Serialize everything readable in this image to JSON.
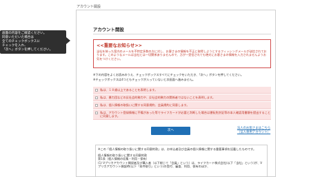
{
  "window": {
    "title": "アカウント開設"
  },
  "tooltip": {
    "lines": [
      "画面の内容をご確認ください。",
      "同意いただいた場合は",
      "全てのチェックボックスに",
      "チェックを入れ、",
      "「次へ」ボタンを押してください。"
    ]
  },
  "page": {
    "title": "アカウント開設"
  },
  "notice": {
    "heading": "<<重要なお知らせ>>",
    "text": "当社を装った案内のメールを不特定多数の方に対し、お客さまの情報を不正に取得しようとするフィッシングメールが送信されております。このようなメールは当社とは一切関係ありませんので、万が一受信されても絶対にお客さまの情報を入力されませんようお気をつけください。"
  },
  "instructions": {
    "line1": "※下の内容をよくお読みのうえ、チェックボックスすべてにチェックをいただき、「次へ」ボタンを押してください。",
    "line2": "※チェックボックスは4つともチェックが入っていないと次画面へ進みません。"
  },
  "agreements": [
    "私は、１８歳以上であることを表明します。",
    "私は、暴力団などの反社会的勢力や、反社会的勢力の関係者ではないことを表明します。",
    "私は、個人情報の取扱いに関する同意規約、会員規約に同意します。",
    "私は、アカウント登録情報に不備があった等でライフカードが必要と判断した場合は運転免許証等の本人確認用書類を提出することに同意します。"
  ],
  "buttons": {
    "next": "次へ"
  },
  "links": {
    "corporate_line1": "法人のお客さまはこちら",
    "corporate_line2": "（法人専用アカウント）"
  },
  "terms": {
    "lines": [
      "※この「個人情報の取り扱いに関する同意約款」は、お申込者及び会員の個人情報に関する重要事項を記載したものです。",
      "",
      "個人情報の取り扱いに関する同意約款",
      "第1条（個人情報の収集・利用・保有）",
      "(1) Vプリカアカウント開設者及び購入者（以下総じて「会員」という）は、ライフカード株式会社(以下「当社」という)が、Vプリカアカウント開設時(以下「本件取引」という)の受付、審査、利用、保有のほか、"
    ]
  }
}
